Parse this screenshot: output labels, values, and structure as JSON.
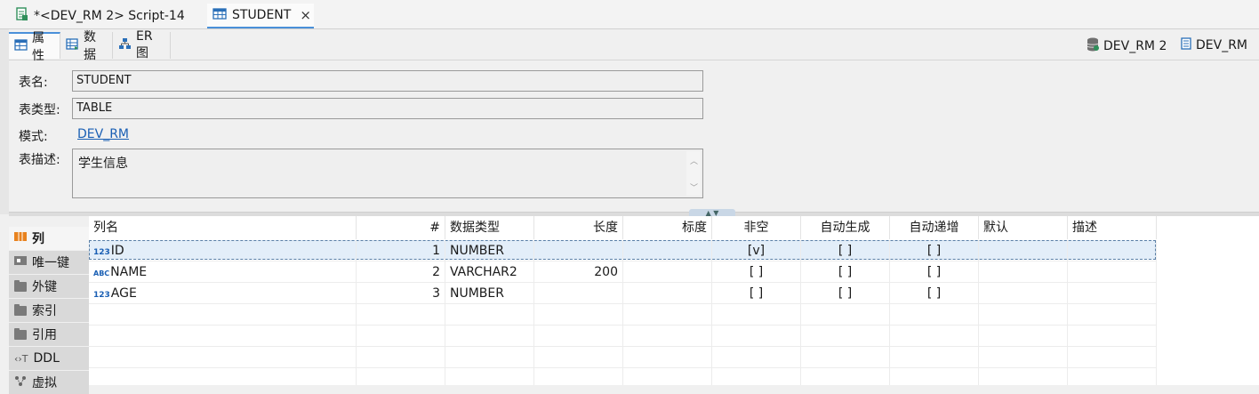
{
  "editor_tabs": [
    {
      "label": "*<DEV_RM 2> Script-14",
      "icon": "sql-script-icon"
    },
    {
      "label": "STUDENT",
      "icon": "table-icon",
      "close": "×"
    }
  ],
  "sub_tabs": [
    {
      "label": "属性",
      "icon": "properties-icon"
    },
    {
      "label": "数据",
      "icon": "data-icon"
    },
    {
      "label": "ER 图",
      "icon": "er-diagram-icon"
    }
  ],
  "connections": {
    "datasource": "DEV_RM 2",
    "schema": "DEV_RM"
  },
  "properties": {
    "table_name_label": "表名:",
    "table_name": "STUDENT",
    "table_type_label": "表类型:",
    "table_type": "TABLE",
    "schema_label": "模式:",
    "schema_link": "DEV_RM",
    "desc_label": "表描述:",
    "description": "学生信息"
  },
  "side_nav": [
    {
      "label": "列",
      "active": true
    },
    {
      "label": "唯一键"
    },
    {
      "label": "外键"
    },
    {
      "label": "索引"
    },
    {
      "label": "引用"
    },
    {
      "label": "DDL"
    },
    {
      "label": "虚拟"
    }
  ],
  "columns_table": {
    "headers": [
      "列名",
      "#",
      "数据类型",
      "长度",
      "标度",
      "非空",
      "自动生成",
      "自动递增",
      "默认",
      "描述"
    ],
    "rows": [
      {
        "type_icon": "123",
        "name": "ID",
        "pos": "1",
        "datatype": "NUMBER",
        "length": "",
        "scale": "",
        "not_null": "[v]",
        "auto_gen": "[ ]",
        "auto_inc": "[ ]",
        "default": "",
        "desc": ""
      },
      {
        "type_icon": "ABC",
        "name": "NAME",
        "pos": "2",
        "datatype": "VARCHAR2",
        "length": "200",
        "scale": "",
        "not_null": "[ ]",
        "auto_gen": "[ ]",
        "auto_inc": "[ ]",
        "default": "",
        "desc": ""
      },
      {
        "type_icon": "123",
        "name": "AGE",
        "pos": "3",
        "datatype": "NUMBER",
        "length": "",
        "scale": "",
        "not_null": "[ ]",
        "auto_gen": "[ ]",
        "auto_inc": "[ ]",
        "default": "",
        "desc": ""
      }
    ]
  },
  "colors": {
    "accent": "#4a90d9",
    "link": "#1a5fb4",
    "selection": "#e3eef9"
  }
}
